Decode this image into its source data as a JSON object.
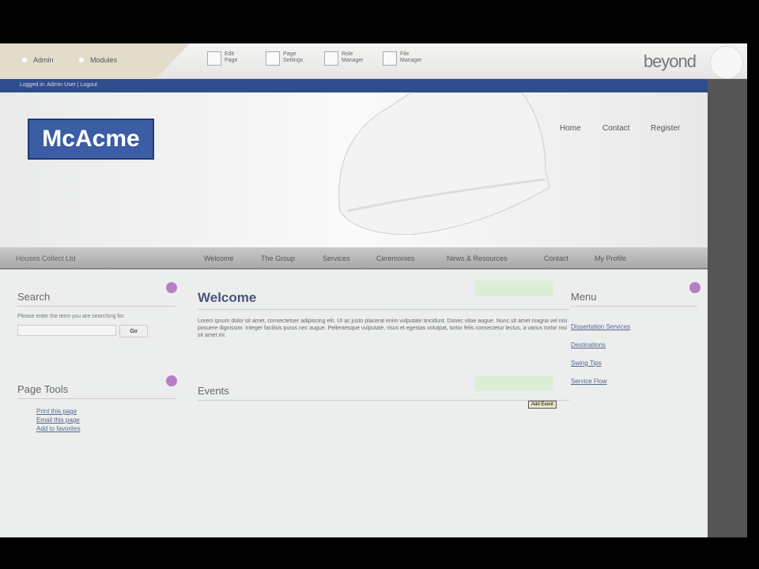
{
  "admin": {
    "modules": [
      "Admin",
      "Modules"
    ],
    "tools": [
      {
        "line1": "Edit",
        "line2": "Page"
      },
      {
        "line1": "Page",
        "line2": "Settings"
      },
      {
        "line1": "Role",
        "line2": "Manager"
      },
      {
        "line1": "File",
        "line2": "Manager"
      }
    ],
    "brand": "beyond"
  },
  "bluebar": {
    "text": "Logged in: Admin User | Logout"
  },
  "header": {
    "logo": "McAcme",
    "links": [
      "Home",
      "Contact",
      "Register"
    ]
  },
  "nav": {
    "brand": "Houses Collect Ltd",
    "items": [
      "Welcome",
      "The Group",
      "Services",
      "Ceremonies",
      "News & Resources",
      "Contact",
      "My Profile"
    ]
  },
  "search": {
    "title": "Search",
    "hint": "Please enter the term you are searching for.",
    "go": "Go"
  },
  "page_tools": {
    "title": "Page Tools",
    "links": [
      "Print this page",
      "Email this page",
      "Add to favorites"
    ]
  },
  "welcome": {
    "title": "Welcome",
    "body": "Lorem ipsum dolor sit amet, consectetuer adipiscing elit. Ut ac justo placerat enim vulputate tincidunt. Donec vitae augue. Nunc sit amet magna vel nisi posuere dignissim. Integer facilisis purus nec augue. Pellentesque vulputate, risus et egestas volutpat, tortor felis consectetur lectus, a varius tortor nisl sit amet mi."
  },
  "events": {
    "title": "Events",
    "tooltip": "Add Event"
  },
  "menu": {
    "title": "Menu",
    "items": [
      "Dissertation Services",
      "Destinations",
      "Swing Tips",
      "Service Flow"
    ]
  }
}
